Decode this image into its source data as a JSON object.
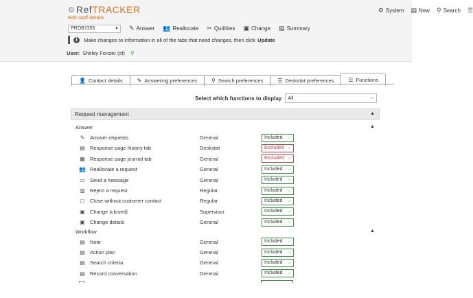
{
  "app": {
    "logo_ref": "Ref",
    "logo_tracker": "TRACKER",
    "subtitle": "Edit staff details"
  },
  "topnav": {
    "system": "System",
    "new": "New",
    "search": "Search"
  },
  "toolbar": {
    "problem_id": "PROB7355",
    "answer": "Answer",
    "reallocate": "Reallocate",
    "qutilities": "Qutilities",
    "change": "Change",
    "summary": "Summary"
  },
  "info": {
    "message": "Make changes to information in all of the tabs that need changes, then click",
    "action": "Update"
  },
  "user": {
    "label": "User:",
    "name": "Shirley Forster (sf)"
  },
  "tabs": [
    "Contact details",
    "Answering preferences",
    "Search preferences",
    "Deskstat preferences",
    "Functions"
  ],
  "filter": {
    "label": "Select which functions to display",
    "value": "All"
  },
  "section": {
    "title": "Request management"
  },
  "groups": [
    {
      "title": "Answer",
      "items": [
        {
          "name": "Answer requests",
          "type": "General",
          "status": "Included",
          "icon": "pencil-icon"
        },
        {
          "name": "Response page history tab",
          "type": "Deskstat",
          "status": "Excluded",
          "icon": "list-icon"
        },
        {
          "name": "Response page journal tab",
          "type": "General",
          "status": "Excluded",
          "icon": "journal-icon"
        },
        {
          "name": "Reallocate a request",
          "type": "General",
          "status": "Included",
          "icon": "users-icon"
        },
        {
          "name": "Send a message",
          "type": "General",
          "status": "Included",
          "icon": "window-icon"
        },
        {
          "name": "Reject a request",
          "type": "Regular",
          "status": "Included",
          "icon": "reject-icon"
        },
        {
          "name": "Close without customer contact",
          "type": "Regular",
          "status": "Included",
          "icon": "folder-icon"
        },
        {
          "name": "Change (closed)",
          "type": "Supervisor",
          "status": "Included",
          "icon": "edit-doc-icon"
        },
        {
          "name": "Change details",
          "type": "General",
          "status": "Included",
          "icon": "edit-doc-icon"
        }
      ]
    },
    {
      "title": "Workflow",
      "items": [
        {
          "name": "Note",
          "type": "General",
          "status": "Included",
          "icon": "note-icon"
        },
        {
          "name": "Action plan",
          "type": "General",
          "status": "Included",
          "icon": "note-icon"
        },
        {
          "name": "Search criteria",
          "type": "General",
          "status": "Included",
          "icon": "note-icon"
        },
        {
          "name": "Record conversation",
          "type": "General",
          "status": "Included",
          "icon": "note-icon"
        }
      ]
    }
  ]
}
